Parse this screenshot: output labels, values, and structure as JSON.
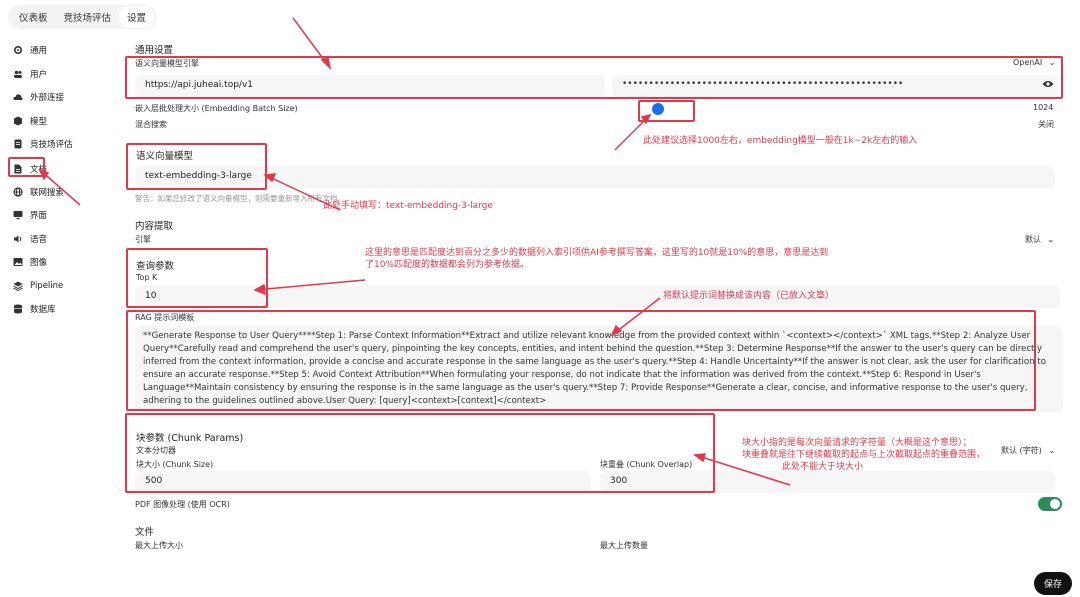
{
  "tabs": [
    {
      "label": "仪表板"
    },
    {
      "label": "竞技场评估"
    },
    {
      "label": "设置"
    }
  ],
  "sidebar": {
    "items": [
      {
        "label": "通用"
      },
      {
        "label": "用户"
      },
      {
        "label": "外部连接"
      },
      {
        "label": "模型"
      },
      {
        "label": "竞技场评估"
      },
      {
        "label": "文档"
      },
      {
        "label": "联网搜索"
      },
      {
        "label": "界面"
      },
      {
        "label": "语音"
      },
      {
        "label": "图像"
      },
      {
        "label": "Pipeline"
      },
      {
        "label": "数据库"
      }
    ]
  },
  "general": {
    "title": "通用设置",
    "embedding_engine_label": "语义向量模型引擎",
    "embedding_engine_value": "OpenAI",
    "api_url": "https://api.juheai.top/v1",
    "api_key_mask": "•••••••••••••••••••••••••••••••••••••••••••••••••••••",
    "batch_size_label": "嵌入层批处理大小 (Embedding Batch Size)",
    "batch_size_value": "1024",
    "hybrid_search_label": "混合搜索",
    "hybrid_search_value": "关闭"
  },
  "embedding_model": {
    "title": "语义向量模型",
    "value": "text-embedding-3-large",
    "warning": "警告：如果您修改了语义向量模型，则需要重新导入所有文档。"
  },
  "content_extraction": {
    "title": "内容提取",
    "engine_label": "引擎",
    "engine_value": "默认"
  },
  "query_params": {
    "title": "查询参数",
    "topk_label": "Top K",
    "topk_value": "10"
  },
  "rag": {
    "title": "RAG 提示词模板",
    "template": "**Generate Response to User Query****Step 1: Parse Context Information**Extract and utilize relevant knowledge from the provided context within `<context></context>` XML tags.**Step 2: Analyze User Query**Carefully read and comprehend the user's query, pinpointing the key concepts, entities, and intent behind the question.**Step 3: Determine Response**If the answer to the user's query can be directly inferred from the context information, provide a concise and accurate response in the same language as the user's query.**Step 4: Handle Uncertainty**If the answer is not clear, ask the user for clarification to ensure an accurate response.**Step 5: Avoid Context Attribution**When formulating your response, do not indicate that the information was derived from the context.**Step 6: Respond in User's Language**Maintain consistency by ensuring the response is in the same language as the user's query.**Step 7: Provide Response**Generate a clear, concise, and informative response to the user's query, adhering to the guidelines outlined above.User Query: [query]<context>[context]</context>"
  },
  "chunk": {
    "title": "块参数 (Chunk Params)",
    "splitter_label": "文本分切器",
    "splitter_value": "默认 (字符)",
    "size_label": "块大小 (Chunk Size)",
    "size_value": "500",
    "overlap_label": "块重叠 (Chunk Overlap)",
    "overlap_value": "300",
    "pdf_ocr_label": "PDF 图像处理 (使用 OCR)"
  },
  "files": {
    "title": "文件",
    "max_size_label": "最大上传大小",
    "max_count_label": "最大上传数量"
  },
  "save_label": "保存",
  "annotations": {
    "batch_note": "此处建议选择1000左右，embedding模型一般在1k~2k左右的输入",
    "model_note": "此处手动填写：text-embedding-3-large",
    "topk_note_1": "这里的意思是匹配度达到百分之多少的数据列入索引项供AI参考撰写答案，这里写的10就是10%的意思，意思是达到",
    "topk_note_2": "了10%匹配度的数据都会列为参考依据。",
    "rag_note": "将默认提示词替换成该内容（已放入文章）",
    "chunk_note_1": "块大小指的是每次向量请求的字符量（大概是这个意思）；",
    "chunk_note_2": "块重叠就是往下继续截取的起点与上次截取起点的重叠范围，",
    "chunk_note_3": "此处不能大于块大小",
    "accent_color": "#e0394d"
  }
}
